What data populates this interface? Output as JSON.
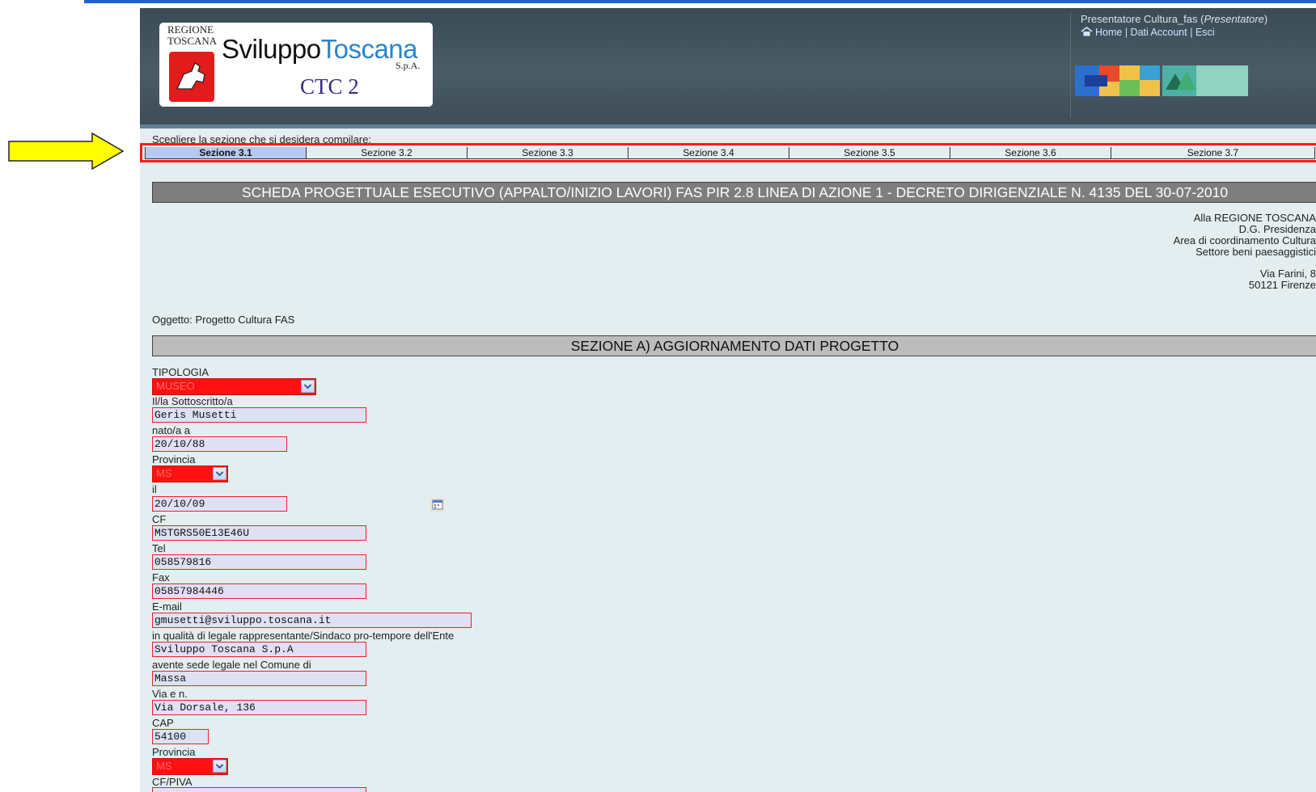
{
  "header": {
    "logo": {
      "regione": "REGIONE\nTOSCANA",
      "brand_part1": "Sviluppo",
      "brand_part2": "Toscana",
      "spa": "S.p.A.",
      "product": "CTC 2"
    },
    "user": {
      "name": "Presentatore Cultura_fas",
      "role": "Presentatore",
      "links": [
        "Home",
        "Dati Account",
        "Esci"
      ]
    }
  },
  "sections": {
    "prompt": "Scegliere la sezione che si desidera compilare:",
    "tabs": [
      "Sezione 3.1",
      "Sezione 3.2",
      "Sezione 3.3",
      "Sezione 3.4",
      "Sezione 3.5",
      "Sezione 3.6",
      "Sezione 3.7"
    ],
    "active": "Sezione 3.1"
  },
  "document": {
    "title": "SCHEDA PROGETTUALE ESECUTIVO (APPALTO/INIZIO LAVORI) FAS PIR 2.8 LINEA DI AZIONE 1 - DECRETO DIRIGENZIALE N. 4135 DEL 30-07-2010",
    "recipient": [
      "Alla REGIONE TOSCANA",
      "D.G. Presidenza",
      "Area di coordinamento Cultura",
      "Settore beni paesaggistici"
    ],
    "address": [
      "Via Farini, 8",
      "50121 Firenze"
    ],
    "oggetto": "Oggetto: Progetto Cultura FAS",
    "section_a": "SEZIONE A) AGGIORNAMENTO DATI PROGETTO"
  },
  "form": {
    "tipologia": {
      "label": "TIPOLOGIA",
      "value": "MUSEO"
    },
    "sottoscritto": {
      "label": "Il/la Sottoscritto/a",
      "value": "Geris Musetti"
    },
    "nato_a": {
      "label": "nato/a a",
      "value": "20/10/88"
    },
    "provincia_nascita": {
      "label": "Provincia",
      "value": "MS"
    },
    "il": {
      "label": "il",
      "value": "20/10/09"
    },
    "cf": {
      "label": "CF",
      "value": "MSTGRS50E13E46U"
    },
    "tel": {
      "label": "Tel",
      "value": "058579816"
    },
    "fax": {
      "label": "Fax",
      "value": "05857984446"
    },
    "email": {
      "label": "E-mail",
      "value": "gmusetti@sviluppo.toscana.it"
    },
    "ente": {
      "label": "in qualità di legale rappresentante/Sindaco pro-tempore dell'Ente",
      "value": "Sviluppo Toscana S.p.A"
    },
    "comune": {
      "label": "avente sede legale nel Comune di",
      "value": "Massa"
    },
    "via": {
      "label": "Via e n.",
      "value": "Via Dorsale, 136"
    },
    "cap": {
      "label": "CAP",
      "value": "54100"
    },
    "provincia_sede": {
      "label": "Provincia",
      "value": "MS"
    },
    "cfpiva": {
      "label": "CF/PIVA",
      "value": ""
    }
  }
}
